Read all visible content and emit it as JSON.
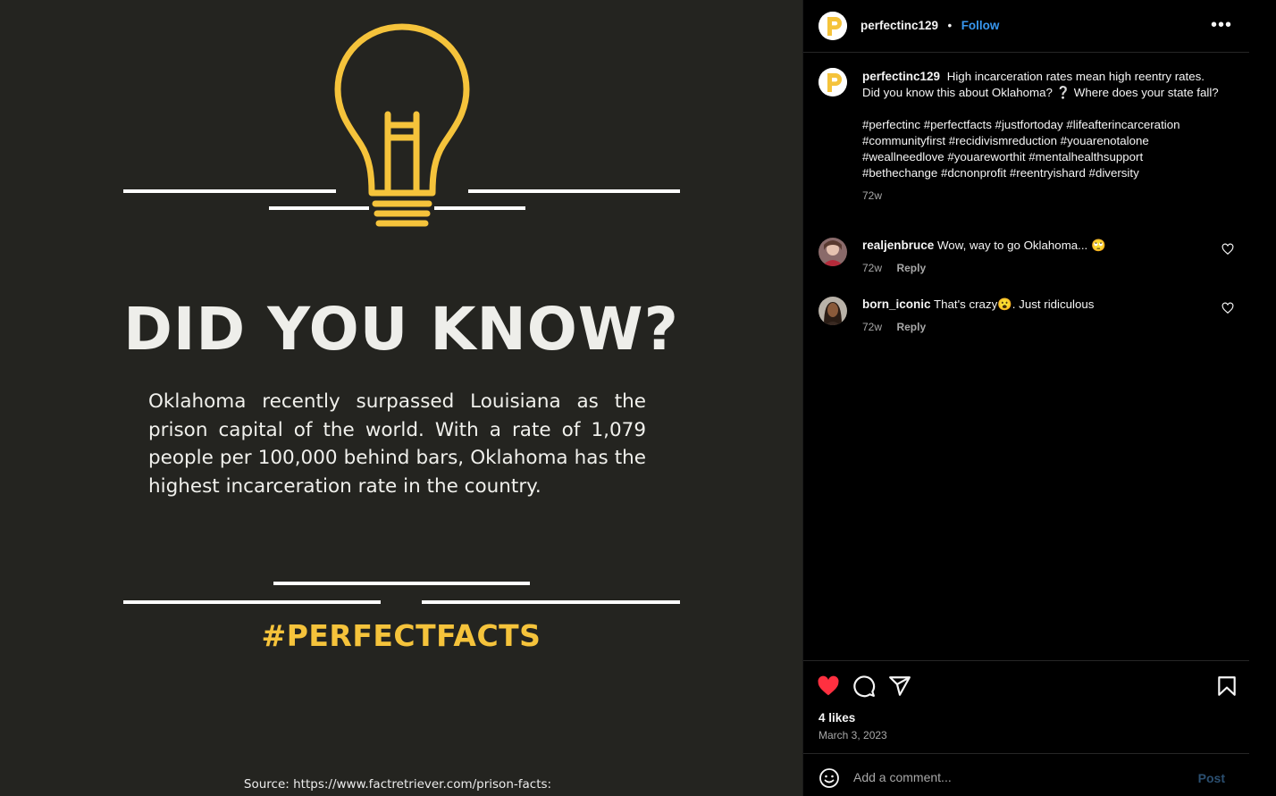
{
  "post": {
    "headline": "DID YOU KNOW?",
    "body": "Oklahoma recently surpassed Louisiana as the prison capital of the world. With a rate of 1,079 people per 100,000 behind bars, Oklahoma has the highest incarceration rate in the country.",
    "hashtag": "#PERFECTFACTS",
    "source": "Source: https://www.factretriever.com/prison-facts:",
    "accent_color": "#f5c33b",
    "background_color": "#242420"
  },
  "header": {
    "username": "perfectinc129",
    "separator": "•",
    "follow_label": "Follow",
    "more_icon": "more-horizontal-icon"
  },
  "caption": {
    "username": "perfectinc129",
    "text": "High incarceration rates mean high reentry rates. Did you know this about Oklahoma? ❔ Where does your state fall?",
    "hashtags_line1": "#perfectinc #perfectfacts #justfortoday #lifeafterincarceration",
    "hashtags_line2": "#communityfirst #recidivismreduction #youarenotalone",
    "hashtags_line3": "#weallneedlove #youareworthit #mentalhealthsupport",
    "hashtags_line4": "#bethechange #dcnonprofit #reentryishard #diversity",
    "time": "72w"
  },
  "comments": [
    {
      "username": "realjenbruce",
      "text": "Wow, way to go Oklahoma... 🙄",
      "time": "72w",
      "reply_label": "Reply"
    },
    {
      "username": "born_iconic",
      "text": "That's crazy😮. Just ridiculous",
      "time": "72w",
      "reply_label": "Reply"
    }
  ],
  "actions": {
    "likes": "4 likes",
    "date": "March 3, 2023",
    "like_color": "#ff3040"
  },
  "add_comment": {
    "placeholder": "Add a comment...",
    "post_label": "Post"
  }
}
